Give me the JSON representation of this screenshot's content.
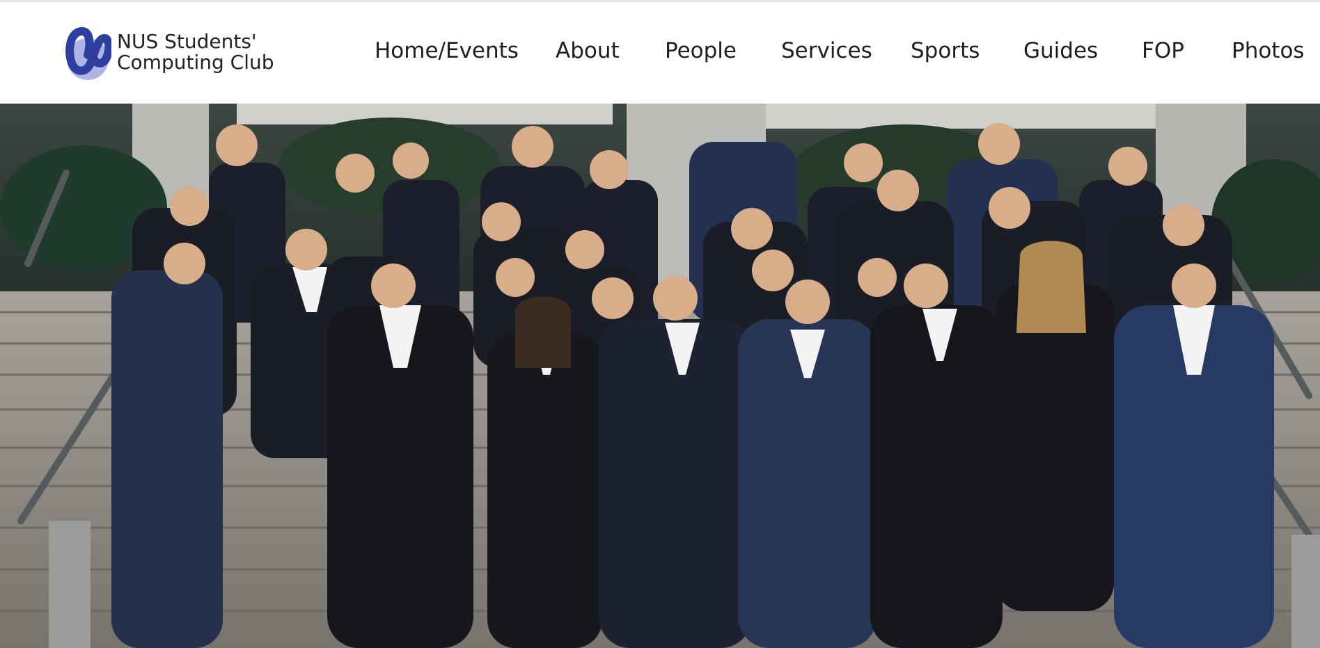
{
  "site": {
    "logo_icon": "nus-computing-club-logo",
    "name_line1": "NUS Students'",
    "name_line2": "Computing Club",
    "brand_color": "#2f3f9f",
    "brand_color_light": "#8c95d6"
  },
  "nav": {
    "items": [
      {
        "label": "Home/Events"
      },
      {
        "label": "About"
      },
      {
        "label": "People"
      },
      {
        "label": "Services"
      },
      {
        "label": "Sports"
      },
      {
        "label": "Guides"
      },
      {
        "label": "FOP"
      },
      {
        "label": "Photos"
      }
    ]
  },
  "hero": {
    "image": "group-photo-on-stairs",
    "suit_color": "#1c1f2b",
    "navy_suit_color": "#23304f",
    "stair_color": "#8a8a88"
  }
}
